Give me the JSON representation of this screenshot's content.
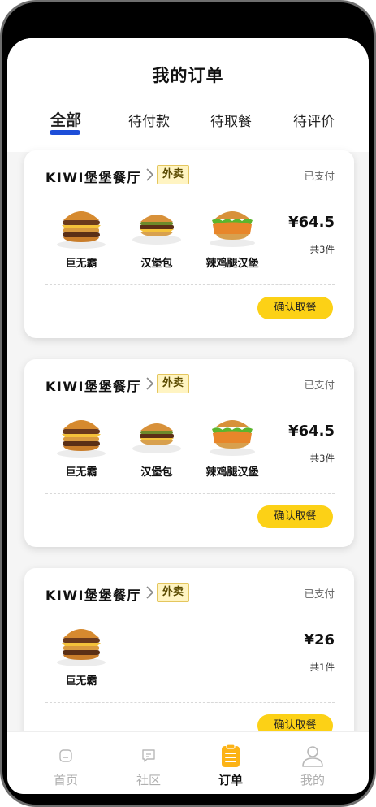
{
  "header": {
    "title": "我的订单",
    "tabs": [
      "全部",
      "待付款",
      "待取餐",
      "待评价"
    ],
    "active_tab": "全部",
    "accent_color": "#1d4ed8"
  },
  "orders": [
    {
      "shop": "KIWI堡堡餐厅",
      "badge": "外卖",
      "status": "已支付",
      "items": [
        {
          "name": "巨无霸",
          "icon": "big-mac-icon"
        },
        {
          "name": "汉堡包",
          "icon": "hamburger-icon"
        },
        {
          "name": "辣鸡腿汉堡",
          "icon": "spicy-chicken-burger-icon"
        }
      ],
      "price": "¥64.5",
      "count": "共3件",
      "action": "确认取餐"
    },
    {
      "shop": "KIWI堡堡餐厅",
      "badge": "外卖",
      "status": "已支付",
      "items": [
        {
          "name": "巨无霸",
          "icon": "big-mac-icon"
        },
        {
          "name": "汉堡包",
          "icon": "hamburger-icon"
        },
        {
          "name": "辣鸡腿汉堡",
          "icon": "spicy-chicken-burger-icon"
        }
      ],
      "price": "¥64.5",
      "count": "共3件",
      "action": "确认取餐"
    },
    {
      "shop": "KIWI堡堡餐厅",
      "badge": "外卖",
      "status": "已支付",
      "items": [
        {
          "name": "巨无霸",
          "icon": "big-mac-icon"
        }
      ],
      "price": "¥26",
      "count": "共1件",
      "action": "确认取餐"
    }
  ],
  "tabbar": {
    "items": [
      {
        "label": "首页",
        "icon": "home-icon"
      },
      {
        "label": "社区",
        "icon": "community-icon"
      },
      {
        "label": "订单",
        "icon": "orders-icon"
      },
      {
        "label": "我的",
        "icon": "profile-icon"
      }
    ],
    "active": "订单",
    "accent_color": "#fcb316"
  },
  "colors": {
    "button": "#fcd116",
    "badge_bg": "#fff4c2"
  }
}
